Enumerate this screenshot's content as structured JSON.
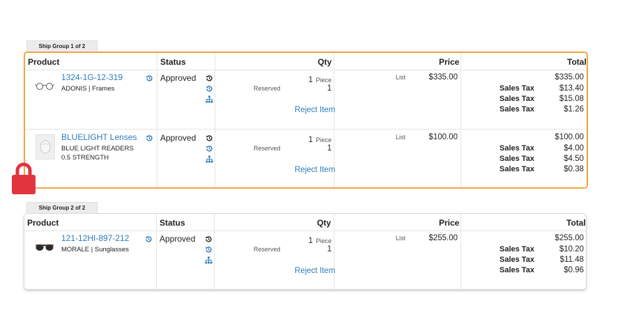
{
  "colors": {
    "accent": "#f2a344",
    "link": "#2b7bbb",
    "lock": "#e0353f"
  },
  "columns": {
    "product": "Product",
    "status": "Status",
    "qty": "Qty",
    "price": "Price",
    "total": "Total"
  },
  "groups": [
    {
      "tab": "Ship Group 1 of 2",
      "items": [
        {
          "link": "1324-1G-12-319",
          "desc": [
            "ADONIS | Frames"
          ],
          "status": "Approved",
          "qty": "1",
          "qty_unit": "Piece",
          "reserved_label": "Reserved",
          "reserved_qty": "1",
          "reject": "Reject Item",
          "price_label": "List",
          "price": "$335.00",
          "total": "$335.00",
          "taxes": [
            {
              "label": "Sales Tax",
              "amount": "$13.40"
            },
            {
              "label": "Sales Tax",
              "amount": "$15.08"
            },
            {
              "label": "Sales Tax",
              "amount": "$1.26"
            }
          ]
        },
        {
          "link": "BLUELIGHT Lenses",
          "desc": [
            "BLUE LIGHT READERS",
            "0.5 STRENGTH"
          ],
          "status": "Approved",
          "qty": "1",
          "qty_unit": "Piece",
          "reserved_label": "Reserved",
          "reserved_qty": "1",
          "reject": "Reject Item",
          "price_label": "List",
          "price": "$100.00",
          "total": "$100.00",
          "taxes": [
            {
              "label": "Sales Tax",
              "amount": "$4.00"
            },
            {
              "label": "Sales Tax",
              "amount": "$4.50"
            },
            {
              "label": "Sales Tax",
              "amount": "$0.38"
            }
          ]
        }
      ]
    },
    {
      "tab": "Ship Group 2 of 2",
      "items": [
        {
          "link": "121-12HI-897-212",
          "desc": [
            "MORALE | Sunglasses"
          ],
          "status": "Approved",
          "qty": "1",
          "qty_unit": "Piece",
          "reserved_label": "Reserved",
          "reserved_qty": "1",
          "reject": "Reject Item",
          "price_label": "List",
          "price": "$255.00",
          "total": "$255.00",
          "taxes": [
            {
              "label": "Sales Tax",
              "amount": "$10.20"
            },
            {
              "label": "Sales Tax",
              "amount": "$11.48"
            },
            {
              "label": "Sales Tax",
              "amount": "$0.96"
            }
          ]
        }
      ]
    }
  ]
}
